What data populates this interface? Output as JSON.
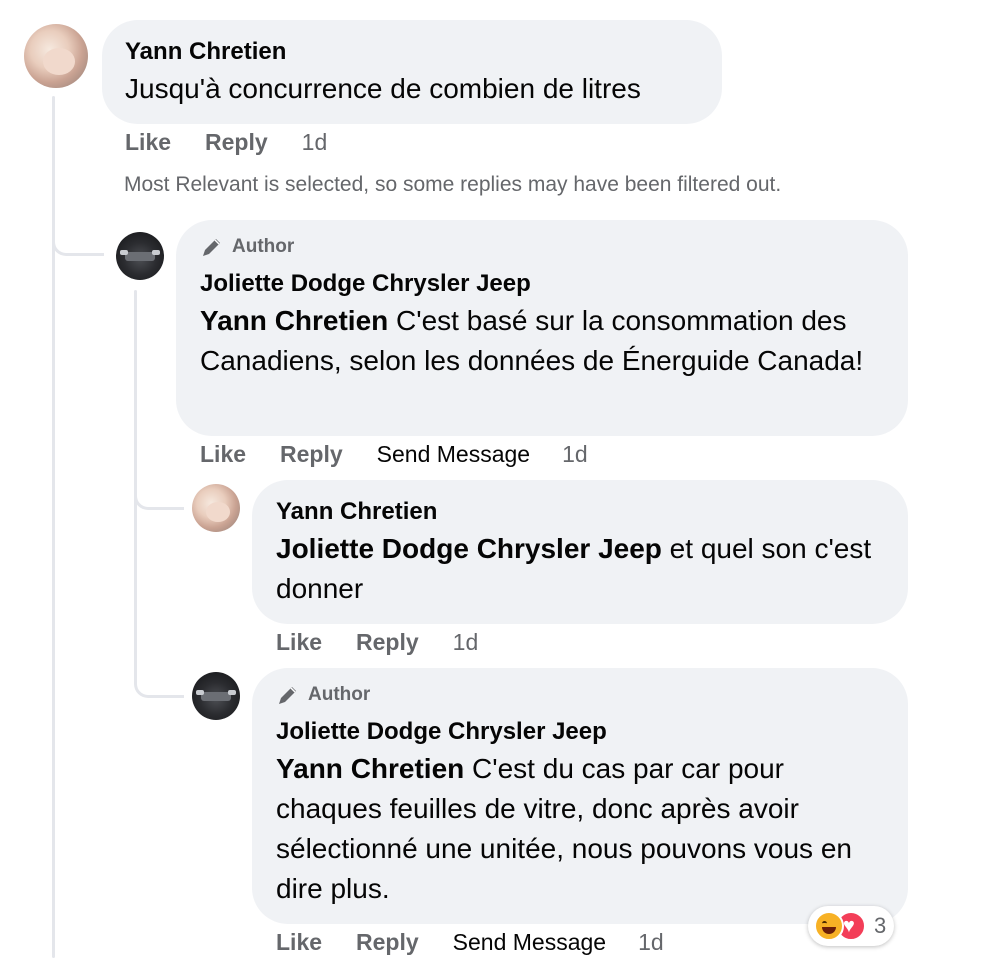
{
  "comments": [
    {
      "author": "Yann Chretien",
      "mention": "",
      "text": "Jusqu'à concurrence de combien de litres",
      "actions": {
        "like": "Like",
        "reply": "Reply",
        "time": "1d"
      }
    },
    {
      "badge": "Author",
      "author": "Joliette Dodge Chrysler Jeep",
      "mention": "Yann Chretien",
      "text": " C'est basé sur la consommation des Canadiens, selon les données de Énerguide Canada!",
      "actions": {
        "like": "Like",
        "reply": "Reply",
        "send": "Send Message",
        "time": "1d"
      }
    },
    {
      "author": "Yann Chretien",
      "mention": "Joliette Dodge Chrysler Jeep",
      "text": " et quel son c'est donner",
      "actions": {
        "like": "Like",
        "reply": "Reply",
        "time": "1d"
      }
    },
    {
      "badge": "Author",
      "author": "Joliette Dodge Chrysler Jeep",
      "mention": "Yann Chretien",
      "text": " C'est du cas par car pour chaques feuilles de vitre, donc après avoir sélectionné une unitée, nous pouvons vous en dire plus.",
      "actions": {
        "like": "Like",
        "reply": "Reply",
        "send": "Send Message",
        "time": "1d"
      },
      "reactions": {
        "icons": [
          "haha-icon",
          "love-icon"
        ],
        "count": "3"
      }
    }
  ],
  "filter_note": "Most Relevant is selected, so some replies may have been filtered out.",
  "colors": {
    "bubble": "#f0f2f5",
    "meta": "#65676b",
    "text": "#050505",
    "thread": "#e4e6eb"
  }
}
